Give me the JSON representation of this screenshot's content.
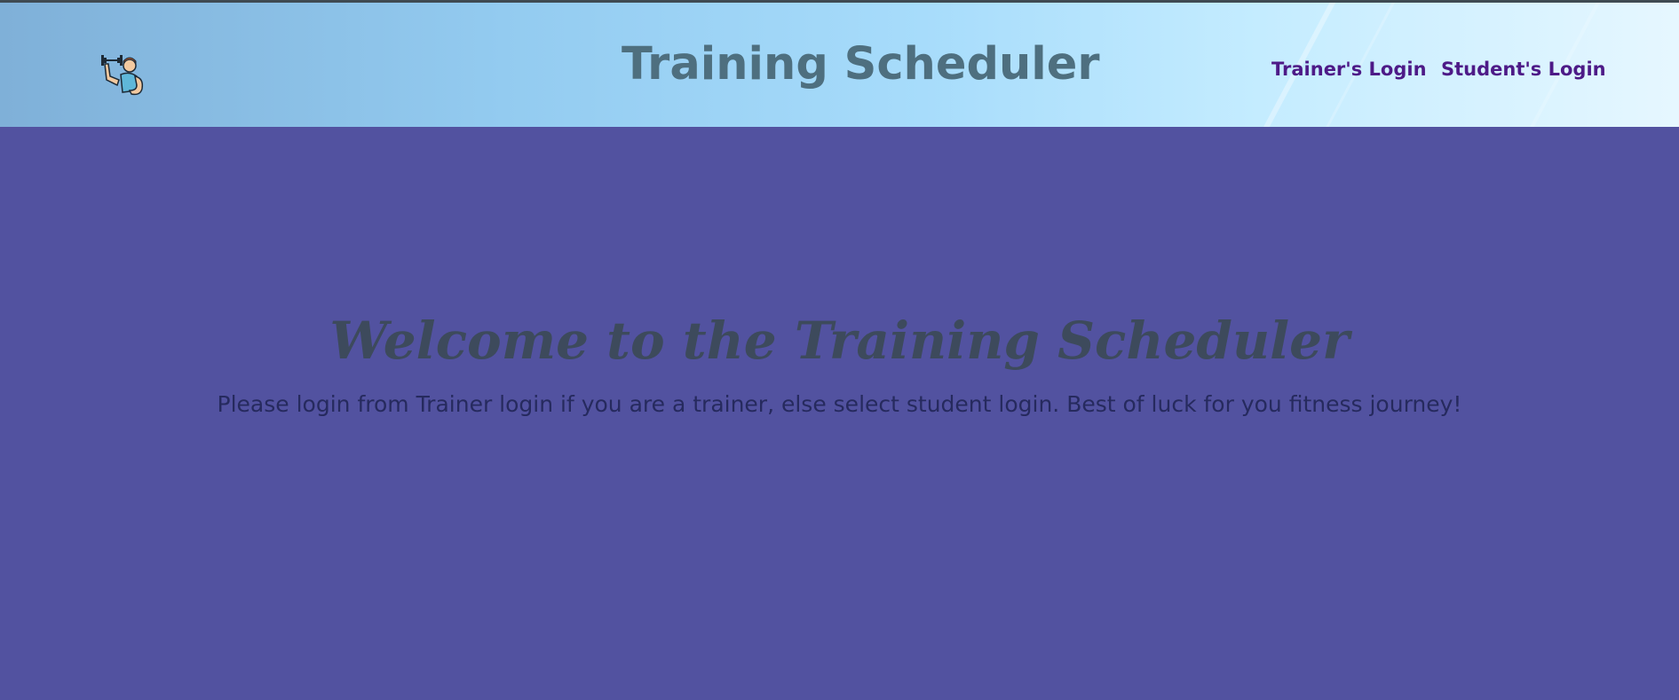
{
  "header": {
    "title": "Training Scheduler",
    "logo_icon": "weightlifter-icon",
    "nav": [
      {
        "label": "Trainer's Login"
      },
      {
        "label": "Student's Login"
      }
    ]
  },
  "main": {
    "heading": "Welcome to the Training Scheduler",
    "subtitle": "Please login from Trainer login if you are a trainer, else select student login. Best of luck for you fitness journey!"
  },
  "colors": {
    "page_background": "#5252a0",
    "title_color": "#4e6f7f",
    "nav_color": "#4d1a87",
    "heading_color": "#3d4a5c",
    "subtitle_color": "#262a5e"
  }
}
